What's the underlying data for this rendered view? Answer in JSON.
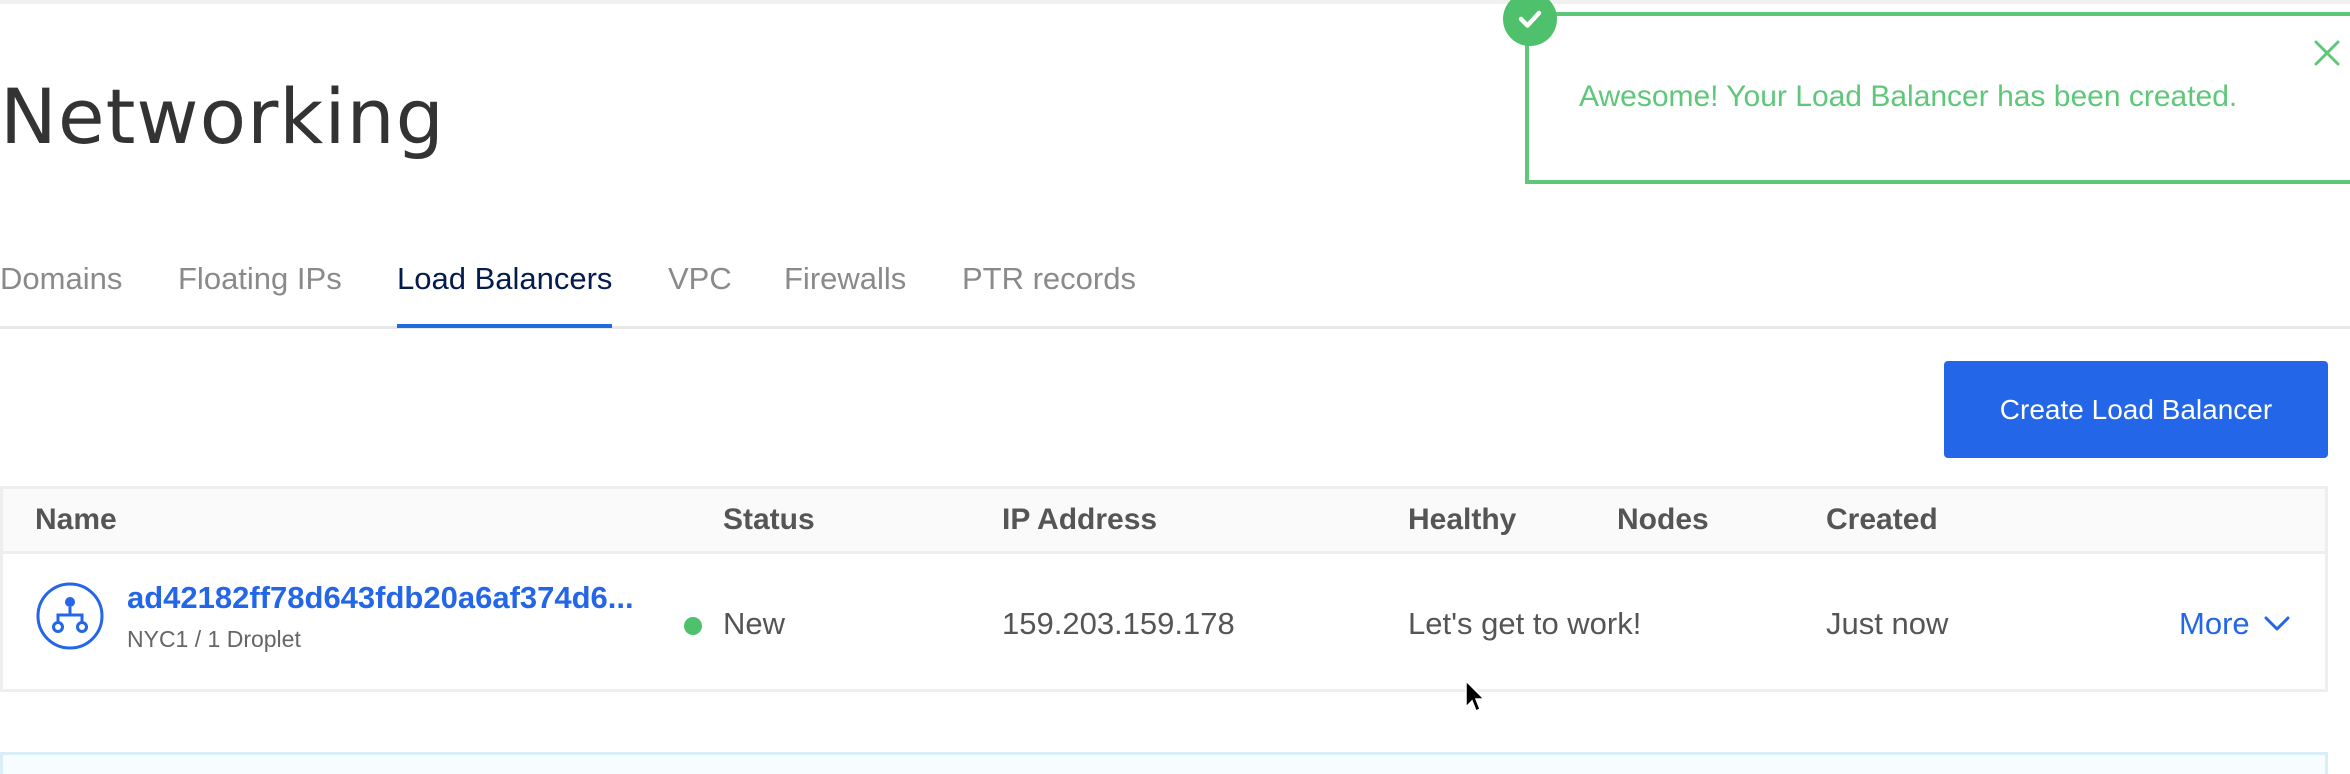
{
  "page": {
    "title": "Networking"
  },
  "toast": {
    "message": "Awesome! Your Load Balancer has been created.",
    "icon": "check-icon",
    "close_icon": "close-icon",
    "color": "#5fc77a"
  },
  "tabs": [
    {
      "label": "Domains",
      "active": false
    },
    {
      "label": "Floating IPs",
      "active": false
    },
    {
      "label": "Load Balancers",
      "active": true
    },
    {
      "label": "VPC",
      "active": false
    },
    {
      "label": "Firewalls",
      "active": false
    },
    {
      "label": "PTR records",
      "active": false
    }
  ],
  "toolbar": {
    "create_label": "Create Load Balancer"
  },
  "table": {
    "columns": [
      "Name",
      "Status",
      "IP Address",
      "Healthy",
      "Nodes",
      "Created"
    ],
    "rows": [
      {
        "icon": "load-balancer-icon",
        "name": "ad42182ff78d643fdb20a6af374d6...",
        "subtitle": "NYC1 / 1 Droplet",
        "status": "New",
        "status_color": "#4fc06b",
        "ip": "159.203.159.178",
        "healthy": "Let's get to work!",
        "created": "Just now",
        "action": "More"
      }
    ]
  },
  "colors": {
    "accent": "#2366e8",
    "active_tab_text": "#031b4e",
    "success": "#4fc06b"
  }
}
